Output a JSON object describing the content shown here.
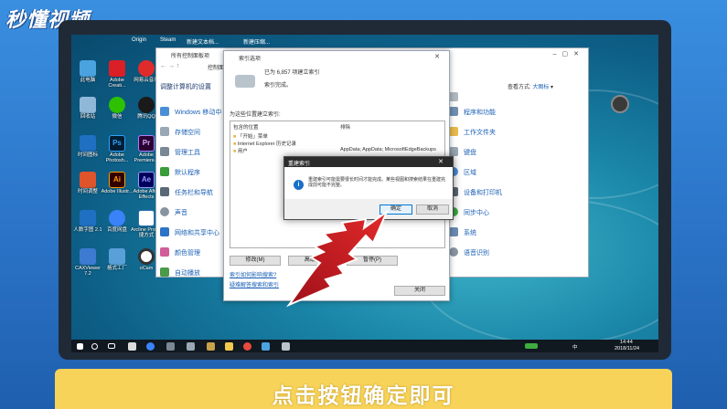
{
  "brand": {
    "logo_text": "秒懂视频"
  },
  "caption": "点击按钮确定即可",
  "top_apps": [
    "Origin",
    "Steam",
    "新建文本档...",
    "新建压缩..."
  ],
  "desktop_icons": [
    {
      "label": "此电脑",
      "color": "#4aa3df"
    },
    {
      "label": "Adobe Creati...",
      "color": "#da1f26"
    },
    {
      "label": "网易云音乐",
      "color": "#e02b2b"
    },
    {
      "label": "回收站",
      "color": "#8fb8d8"
    },
    {
      "label": "微信",
      "color": "#2dc100"
    },
    {
      "label": "腾讯QQ",
      "color": "#1a1a1a"
    },
    {
      "label": "时间图标",
      "color": "#1f6fc2"
    },
    {
      "label": "Adobe Photosh...",
      "color": "#2fa3f7"
    },
    {
      "label": "Adobe Premiere...",
      "color": "#7b3fe4"
    },
    {
      "label": "时间调整",
      "color": "#e0542b"
    },
    {
      "label": "Adobe Illustr...",
      "color": "#ff9a00"
    },
    {
      "label": "Adobe After Effects",
      "color": "#9999ff"
    },
    {
      "label": "人数字图 2.1",
      "color": "#1f6fc2"
    },
    {
      "label": "百度网盘",
      "color": "#3a82f7"
    },
    {
      "label": "Arcline Pro 快捷方式",
      "color": "#2d6fb7"
    },
    {
      "label": "CAXViewer 7.2",
      "color": "#3c7bd1"
    },
    {
      "label": "格式工厂",
      "color": "#5aa0d8"
    },
    {
      "label": "oCam",
      "color": "#ffffff"
    }
  ],
  "control_panel": {
    "title": "所有控制面板项",
    "nav": "控制面",
    "heading": "调整计算机的设置",
    "view_label": "查看方式:",
    "view_value": "大图标",
    "left_items": [
      "Windows 移动中",
      "存储空间",
      "管理工具",
      "默认程序",
      "任务栏和导航",
      "声音",
      "网络和共享中心",
      "颜色管理",
      "自动播放"
    ],
    "right_items": [
      "",
      "程序和功能",
      "工作文件夹",
      "键盘",
      "区域",
      "设备和打印机",
      "同步中心",
      "系统",
      "语音识别"
    ]
  },
  "index_options": {
    "title": "索引选项",
    "status_count": "已为 6,857 项建立索引",
    "status_done": "索引完成。",
    "section_label": "为这些位置建立索引:",
    "col_location": "包含的位置",
    "col_exclude": "排除",
    "rows": [
      {
        "location": "「开始」菜单",
        "exclude": ""
      },
      {
        "location": "Internet Explorer 历史记录",
        "exclude": ""
      },
      {
        "location": "用户",
        "exclude": "AppData; AppData; MicrosoftEdgeBackups"
      }
    ],
    "btn_modify": "修改(M)",
    "btn_advanced": "高级(D)",
    "btn_pause": "暂停(P)",
    "link1": "索引如何影响搜索?",
    "link2": "疑难解答搜索和索引",
    "btn_close": "关闭"
  },
  "rebuild_dialog": {
    "title": "重建索引",
    "message": "重建索引可能需要很长时间才能完成。某些视图和搜索结果在重建完成前可能不完整。",
    "btn_ok": "确定",
    "btn_cancel": "取消"
  },
  "taskbar": {
    "time": "14:44",
    "date": "2018/11/24",
    "lang": "中"
  }
}
